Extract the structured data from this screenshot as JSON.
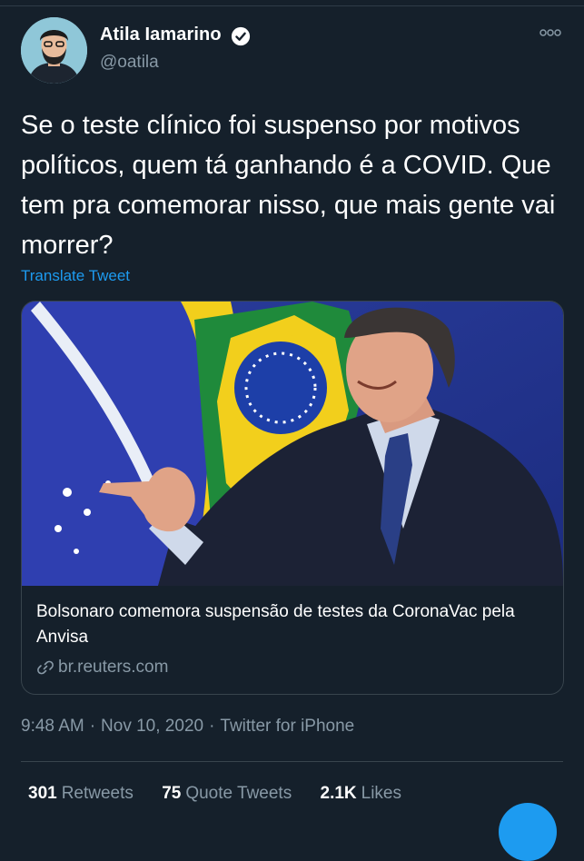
{
  "author": {
    "display_name": "Atila Iamarino",
    "handle": "@oatila",
    "verified_icon": "verified-badge-icon",
    "avatar_icon": "avatar"
  },
  "tweet": {
    "text": "Se o teste clínico foi suspenso por motivos políticos, quem tá ganhando é a COVID. Que tem pra comemorar nisso, que mais gente vai morrer?",
    "translate_label": "Translate Tweet"
  },
  "card": {
    "title": "Bolsonaro comemora suspensão de testes da CoronaVac pela Anvisa",
    "domain": "br.reuters.com",
    "link_icon": "link-icon"
  },
  "meta": {
    "time": "9:48 AM",
    "separator": "·",
    "date": "Nov 10, 2020",
    "source": "Twitter for iPhone"
  },
  "stats": {
    "retweets_count": "301",
    "retweets_label": "Retweets",
    "quotes_count": "75",
    "quotes_label": "Quote Tweets",
    "likes_count": "2.1K",
    "likes_label": "Likes"
  },
  "colors": {
    "background": "#15202b",
    "accent": "#1d9bf0",
    "secondary_text": "#8899a6",
    "border": "#38444d"
  }
}
